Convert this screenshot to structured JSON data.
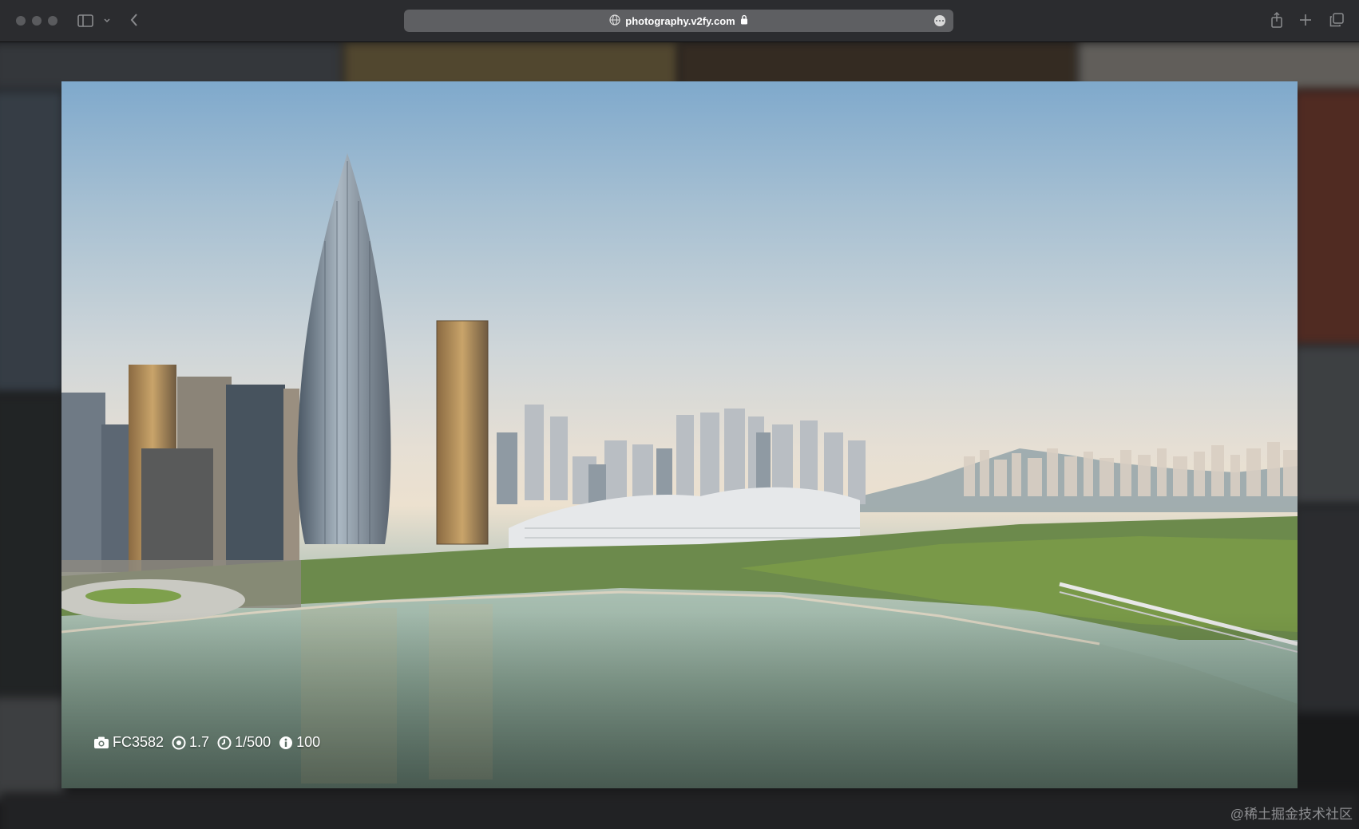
{
  "browser": {
    "url": "photography.v2fy.com",
    "icons": {
      "sidebar": "sidebar-icon",
      "chevron": "chevron-down-icon",
      "back": "back-icon",
      "globe": "globe-icon",
      "lock": "lock-icon",
      "more": "more-icon",
      "share": "share-icon",
      "new_tab": "plus-icon",
      "tabs": "tabs-overview-icon"
    }
  },
  "lightbox": {
    "exif": {
      "camera": "FC3582",
      "aperture": "1.7",
      "shutter": "1/500",
      "iso": "100"
    }
  },
  "watermark": "@稀土掘金技术社区",
  "colors": {
    "toolbar": "#2b2c2f",
    "address_bar": "#5e5f62",
    "text": "#ffffff"
  }
}
